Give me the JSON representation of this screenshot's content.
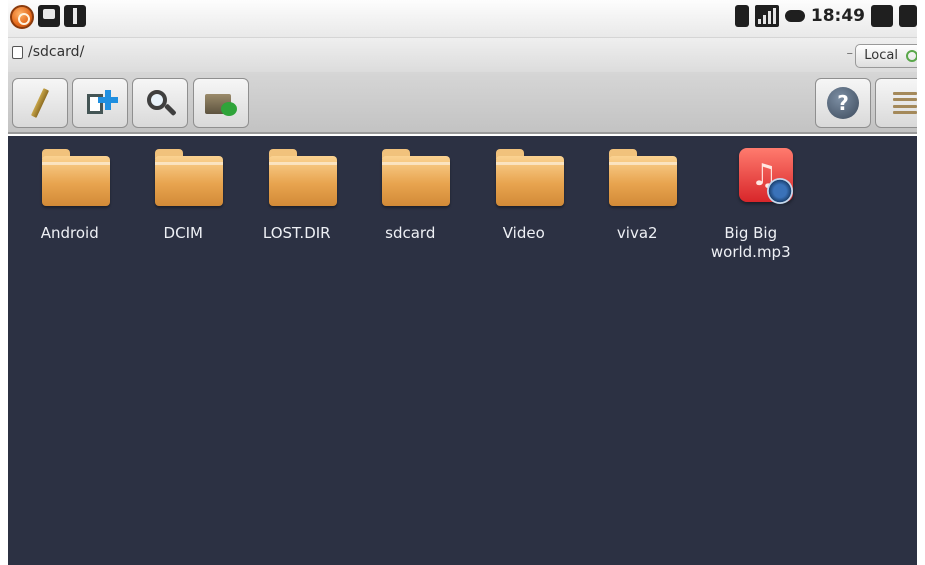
{
  "status_bar": {
    "time": "18:49",
    "notification_icons": [
      "app-notification-icon",
      "sdcard-icon",
      "usb-icon"
    ],
    "system_icons": [
      "sim-icon",
      "signal-icon",
      "battery-icon",
      "volume-down-icon",
      "volume-up-icon"
    ]
  },
  "path_bar": {
    "path": "/sdcard/",
    "location_button": "Local"
  },
  "toolbar": {
    "buttons": [
      "edit-pencil-icon",
      "new-file-icon",
      "search-icon",
      "move-folder-icon"
    ],
    "right_buttons": [
      "help-icon",
      "list-view-icon"
    ],
    "help_glyph": "?"
  },
  "files": [
    {
      "name": "Android",
      "type": "folder"
    },
    {
      "name": "DCIM",
      "type": "folder"
    },
    {
      "name": "LOST.DIR",
      "type": "folder"
    },
    {
      "name": "sdcard",
      "type": "folder"
    },
    {
      "name": "Video",
      "type": "folder"
    },
    {
      "name": "viva2",
      "type": "folder"
    },
    {
      "name": "Big Big world.mp3",
      "type": "audio"
    }
  ],
  "colors": {
    "file_area_background": "#2c3143",
    "folder": "#e8a44f",
    "music_tile": "#d8262a"
  }
}
